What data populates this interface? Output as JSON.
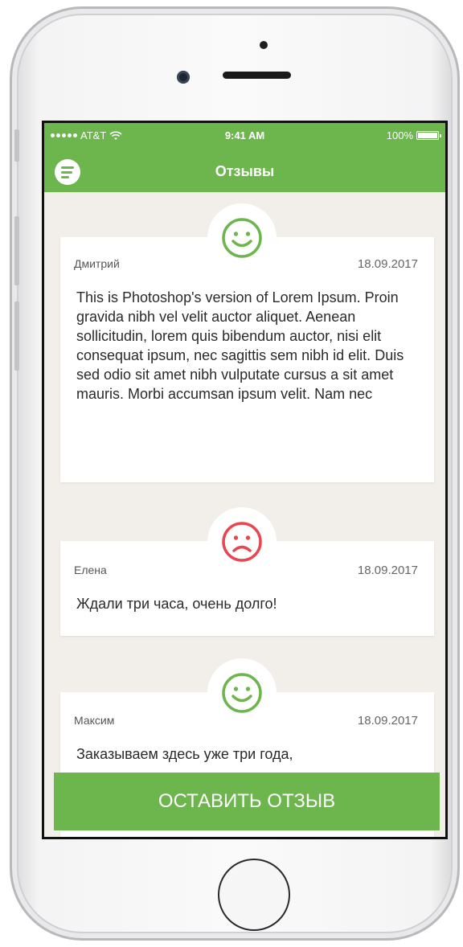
{
  "status_bar": {
    "carrier": "AT&T",
    "time": "9:41 AM",
    "battery": "100%"
  },
  "header": {
    "title": "Отзывы",
    "menu_icon": "menu-icon"
  },
  "colors": {
    "accent": "#6db54d",
    "positive": "#6db54d",
    "negative": "#e8474f",
    "background": "#f2efeb"
  },
  "reviews": [
    {
      "mood": "positive",
      "mood_icon": "happy-face-icon",
      "author": "Дмитрий",
      "date": "18.09.2017",
      "text": "This is Photoshop's version  of Lorem Ipsum. Proin gravida nibh vel velit auctor aliquet. Aenean sollicitudin, lorem quis bibendum auctor, nisi elit consequat ipsum, nec sagittis sem nibh id elit. Duis sed odio sit amet nibh vulputate cursus a sit amet mauris. Morbi accumsan ipsum velit. Nam nec"
    },
    {
      "mood": "negative",
      "mood_icon": "sad-face-icon",
      "author": "Елена",
      "date": "18.09.2017",
      "text": "Ждали три часа, очень долго!"
    },
    {
      "mood": "positive",
      "mood_icon": "happy-face-icon",
      "author": "Максим",
      "date": "18.09.2017",
      "text": "Заказываем здесь уже три года,"
    }
  ],
  "cta": {
    "label": "ОСТАВИТЬ ОТЗЫВ"
  }
}
